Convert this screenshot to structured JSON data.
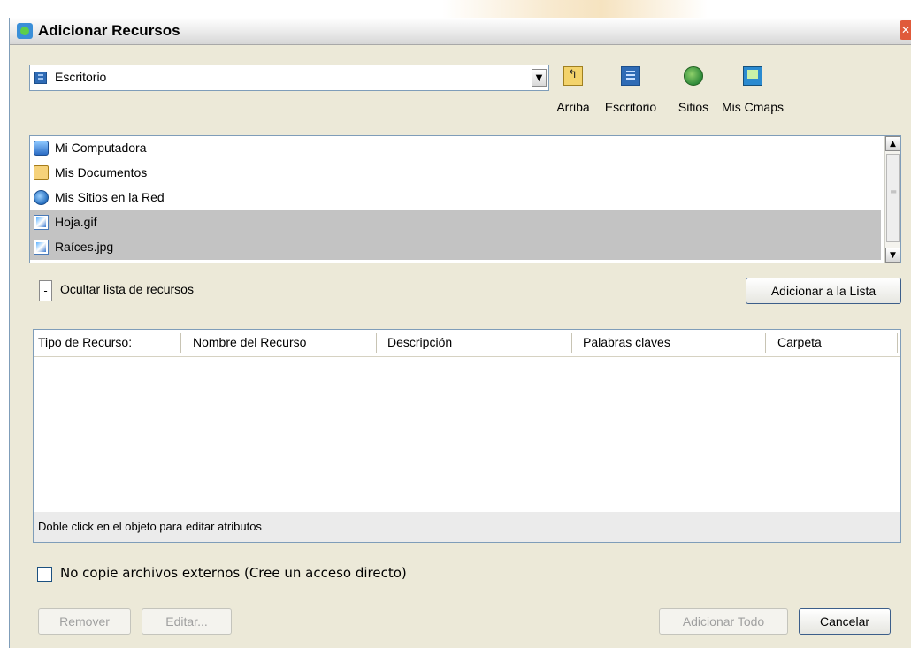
{
  "window": {
    "title": "Adicionar Recursos",
    "close_glyph": "✕"
  },
  "location": {
    "value": "Escritorio",
    "dropdown_glyph": "▼"
  },
  "toolbar": {
    "up_label": "Arriba",
    "desktop_label": "Escritorio",
    "sites_label": "Sitios",
    "cmaps_label": "Mis Cmaps"
  },
  "file_list": {
    "items": [
      {
        "label": "Mi Computadora",
        "icon": "computer-icon",
        "selected": false
      },
      {
        "label": "Mis Documentos",
        "icon": "documents-folder-icon",
        "selected": false
      },
      {
        "label": "Mis Sitios en la Red",
        "icon": "network-places-icon",
        "selected": false
      },
      {
        "label": "Hoja.gif",
        "icon": "image-file-icon",
        "selected": true
      },
      {
        "label": "Raíces.jpg",
        "icon": "image-file-icon",
        "selected": true
      }
    ],
    "scroll_up_glyph": "▲",
    "scroll_down_glyph": "▼"
  },
  "hide_list": {
    "glyph": "-",
    "label": "Ocultar lista de recursos"
  },
  "add_to_list_label": "Adicionar a la Lista",
  "resources_table": {
    "columns": [
      "Tipo de Recurso:",
      "Nombre del Recurso",
      "Descripción",
      "Palabras claves",
      "Carpeta"
    ],
    "rows": [],
    "status_text": "Doble click en el objeto para editar atributos"
  },
  "no_copy_option": {
    "label": "No copie archivos externos (Cree un acceso directo)",
    "checked": false
  },
  "buttons": {
    "remove": "Remover",
    "edit": "Editar...",
    "add_all": "Adicionar Todo",
    "cancel": "Cancelar"
  },
  "colors": {
    "dialog_bg": "#ece9d8",
    "selection_bg": "#c3c3c3",
    "border": "#7f9db9"
  }
}
